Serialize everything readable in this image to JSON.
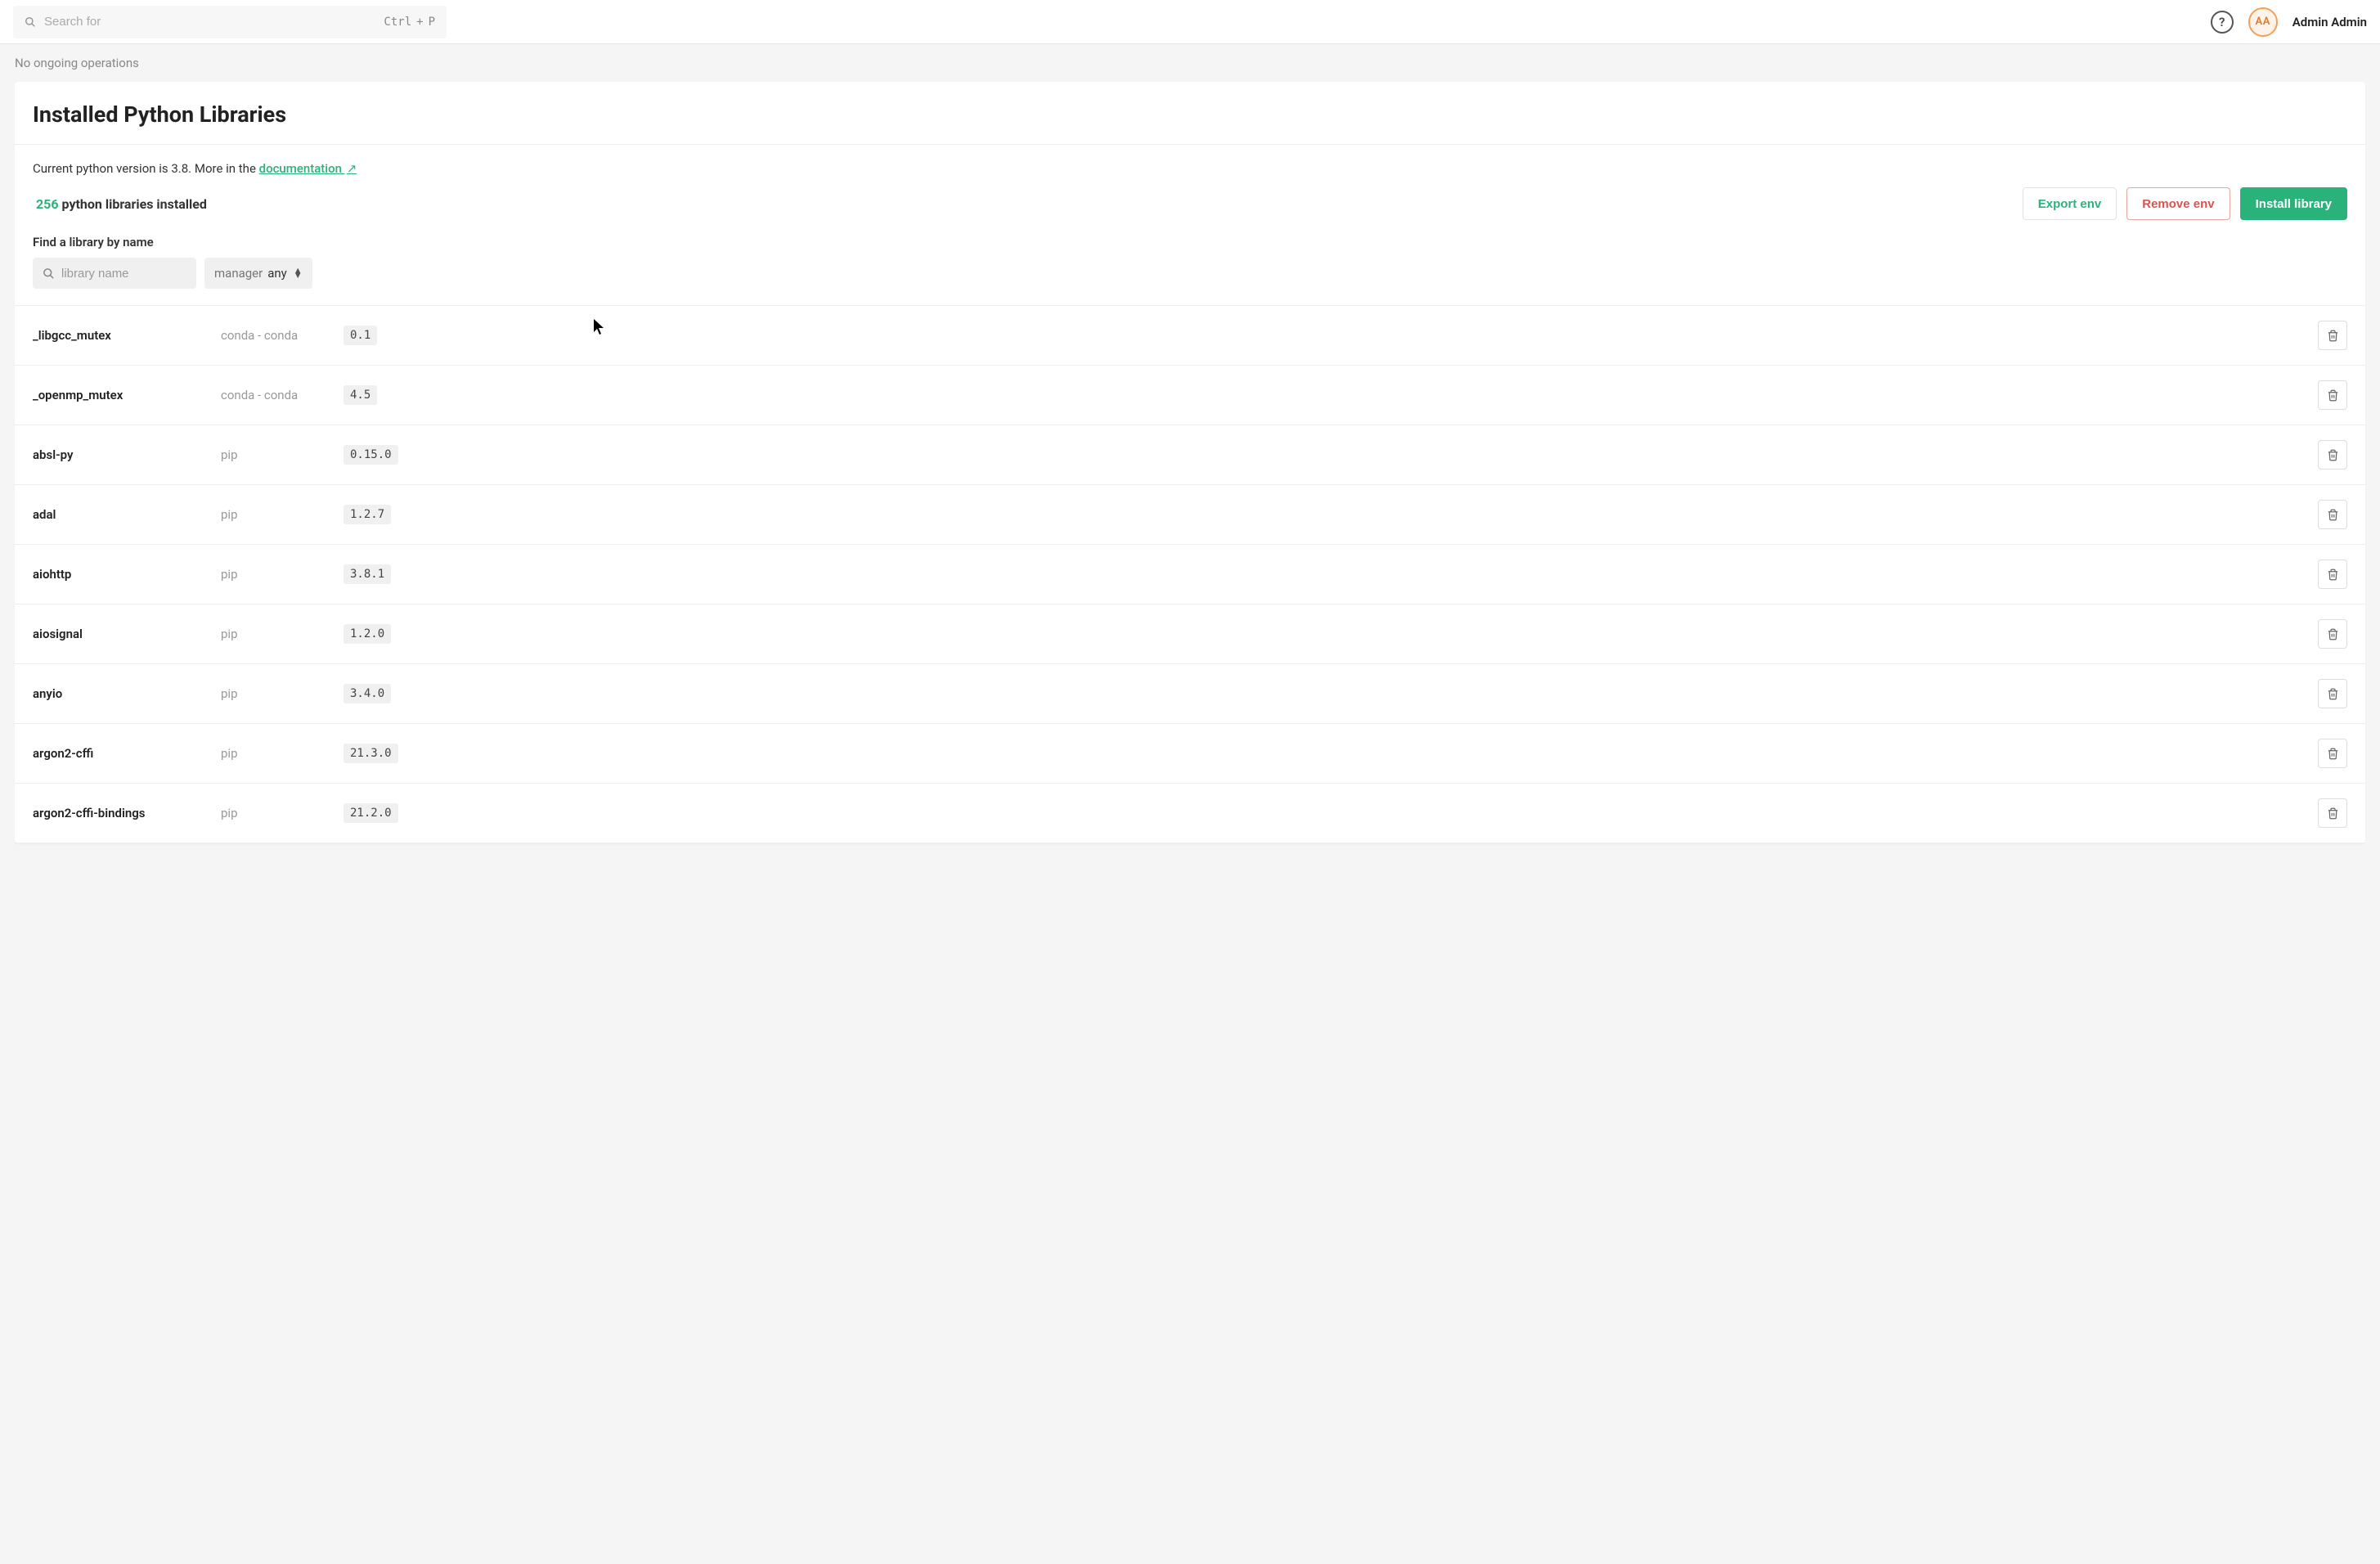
{
  "topbar": {
    "search_placeholder": "Search for",
    "shortcut_ctrl": "Ctrl",
    "shortcut_plus": "+",
    "shortcut_key": "P",
    "help_label": "?",
    "avatar_initials": "AA",
    "username": "Admin Admin"
  },
  "operations": {
    "status": "No ongoing operations"
  },
  "panel": {
    "title": "Installed Python Libraries",
    "version_prefix": "Current python version is 3.8. More in the ",
    "doc_link_text": "documentation",
    "doc_link_icon": "↗",
    "count": "256",
    "count_suffix": " python libraries installed",
    "export_label": "Export env",
    "remove_label": "Remove env",
    "install_label": "Install library"
  },
  "filter": {
    "label": "Find a library by name",
    "placeholder": "library name",
    "manager_label": "manager",
    "manager_value": "any"
  },
  "libraries": [
    {
      "name": "_libgcc_mutex",
      "manager": "conda - conda",
      "version": "0.1"
    },
    {
      "name": "_openmp_mutex",
      "manager": "conda - conda",
      "version": "4.5"
    },
    {
      "name": "absl-py",
      "manager": "pip",
      "version": "0.15.0"
    },
    {
      "name": "adal",
      "manager": "pip",
      "version": "1.2.7"
    },
    {
      "name": "aiohttp",
      "manager": "pip",
      "version": "3.8.1"
    },
    {
      "name": "aiosignal",
      "manager": "pip",
      "version": "1.2.0"
    },
    {
      "name": "anyio",
      "manager": "pip",
      "version": "3.4.0"
    },
    {
      "name": "argon2-cffi",
      "manager": "pip",
      "version": "21.3.0"
    },
    {
      "name": "argon2-cffi-bindings",
      "manager": "pip",
      "version": "21.2.0"
    }
  ]
}
